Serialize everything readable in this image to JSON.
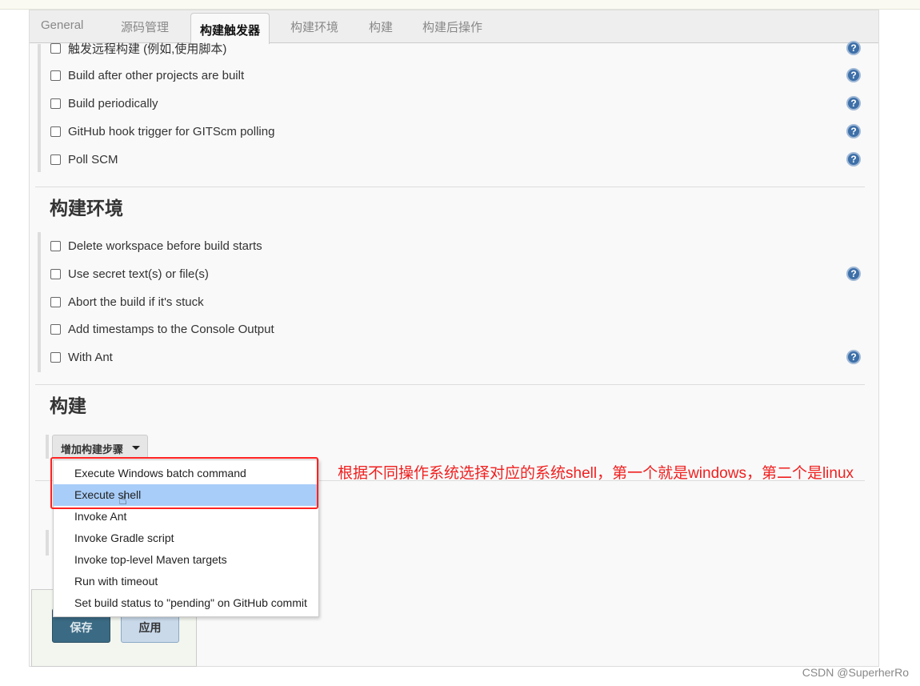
{
  "tabs": [
    {
      "label": "General"
    },
    {
      "label": "源码管理"
    },
    {
      "label": "构建触发器",
      "active": true
    },
    {
      "label": "构建环境"
    },
    {
      "label": "构建"
    },
    {
      "label": "构建后操作"
    }
  ],
  "triggers": [
    {
      "label": "触发远程构建 (例如,使用脚本)",
      "help": true
    },
    {
      "label": "Build after other projects are built",
      "help": true
    },
    {
      "label": "Build periodically",
      "help": true
    },
    {
      "label": "GitHub hook trigger for GITScm polling",
      "help": true
    },
    {
      "label": "Poll SCM",
      "help": true
    }
  ],
  "env": {
    "title": "构建环境",
    "items": [
      {
        "label": "Delete workspace before build starts",
        "help": false
      },
      {
        "label": "Use secret text(s) or file(s)",
        "help": true
      },
      {
        "label": "Abort the build if it's stuck",
        "help": false
      },
      {
        "label": "Add timestamps to the Console Output",
        "help": false
      },
      {
        "label": "With Ant",
        "help": true
      }
    ]
  },
  "build": {
    "title": "构建",
    "add_step_label": "增加构建步骤",
    "menu": [
      {
        "label": "Execute Windows batch command"
      },
      {
        "label": "Execute shell",
        "highlighted": true
      },
      {
        "label": "Invoke Ant"
      },
      {
        "label": "Invoke Gradle script"
      },
      {
        "label": "Invoke top-level Maven targets"
      },
      {
        "label": "Run with timeout"
      },
      {
        "label": "Set build status to \"pending\" on GitHub commit"
      }
    ]
  },
  "annotation": "根据不同操作系统选择对应的系统shell，第一个就是windows，第二个是linux",
  "buttons": {
    "save": "保存",
    "apply": "应用"
  },
  "help_glyph": "?",
  "watermark": "CSDN @SuperherRo",
  "colors": {
    "annotation": "#f02020",
    "highlight": "#a8cdf8",
    "save": "#3b6a84"
  }
}
